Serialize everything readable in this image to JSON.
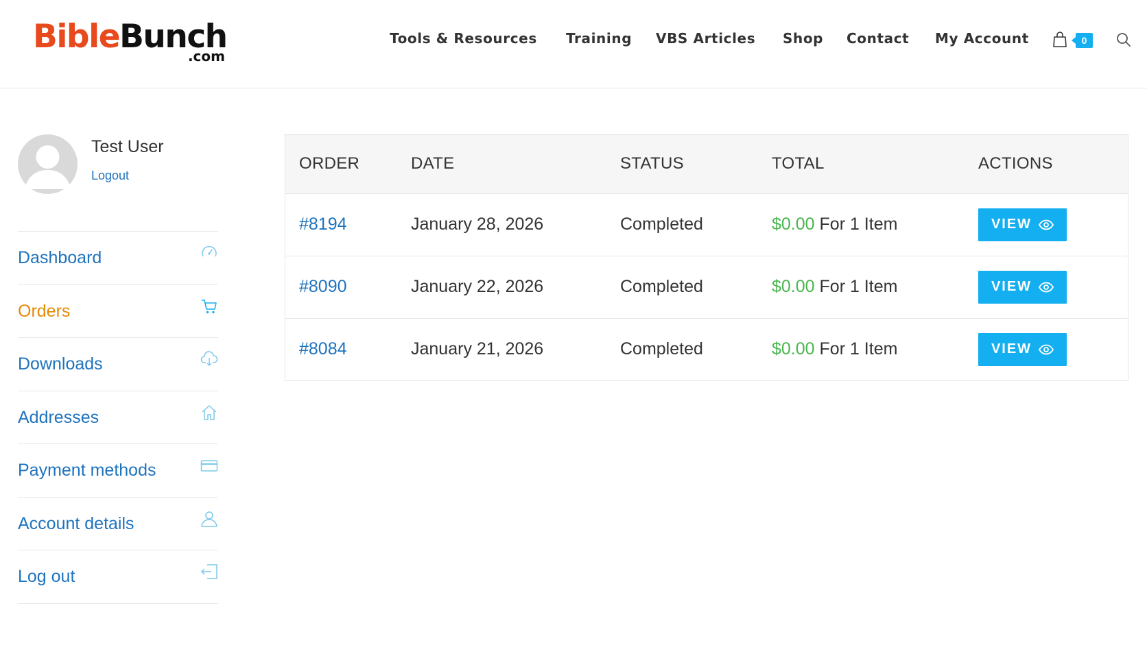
{
  "brand": {
    "part1": "Bible",
    "part2": "Bunch",
    "suffix": ".com",
    "colors": {
      "part1": "#e8491d",
      "part2": "#111111"
    }
  },
  "nav": {
    "items": [
      {
        "label": "Tools & Resources"
      },
      {
        "label": "Training"
      },
      {
        "label": "VBS Articles"
      },
      {
        "label": "Shop"
      },
      {
        "label": "Contact"
      },
      {
        "label": "My Account"
      }
    ],
    "cart_icon": "shopping-bag-icon",
    "cart_count": "0",
    "search_icon": "search-icon"
  },
  "user": {
    "name": "Test User",
    "logout_label": "Logout"
  },
  "account_nav": [
    {
      "label": "Dashboard",
      "icon": "dashboard-gauge-icon",
      "active": false
    },
    {
      "label": "Orders",
      "icon": "cart-icon",
      "active": true
    },
    {
      "label": "Downloads",
      "icon": "cloud-download-icon",
      "active": false
    },
    {
      "label": "Addresses",
      "icon": "home-icon",
      "active": false
    },
    {
      "label": "Payment methods",
      "icon": "credit-card-icon",
      "active": false
    },
    {
      "label": "Account details",
      "icon": "user-icon",
      "active": false
    },
    {
      "label": "Log out",
      "icon": "logout-icon",
      "active": false
    }
  ],
  "orders": {
    "columns": [
      "ORDER",
      "DATE",
      "STATUS",
      "TOTAL",
      "ACTIONS"
    ],
    "rows": [
      {
        "order": "#8194",
        "date": "January 28, 2026",
        "status": "Completed",
        "amount": "$0.00",
        "items": "For 1 Item",
        "action": "VIEW"
      },
      {
        "order": "#8090",
        "date": "January 22, 2026",
        "status": "Completed",
        "amount": "$0.00",
        "items": "For 1 Item",
        "action": "VIEW"
      },
      {
        "order": "#8084",
        "date": "January 21, 2026",
        "status": "Completed",
        "amount": "$0.00",
        "items": "For 1 Item",
        "action": "VIEW"
      }
    ]
  },
  "colors": {
    "accent": "#13aff0",
    "link": "#1e73be",
    "active": "#e48a06",
    "amount": "#49b54d"
  }
}
